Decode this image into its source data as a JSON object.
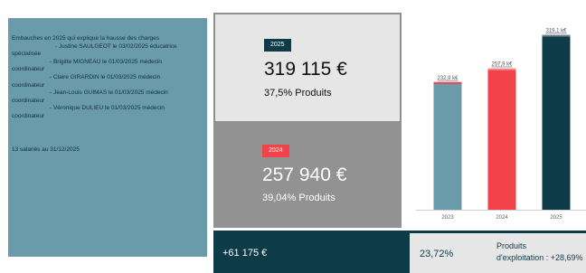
{
  "notes": {
    "lines": [
      "Embauches en 2025 qui explique la hausse des charges",
      "- Justine SAULGEOT le 03/02/2025 éducatrice",
      "spécialisée",
      "- Brigitte MIGNEAU le 01/03/2025 médecin",
      "coordinateur",
      "- Claire GIRARDIN le 01/03/2025 médecin",
      "coordinateur",
      "- Jean-Louis GUIMAS le 01/03/2025 médecin",
      "coordinateur",
      "- Véronique DULIEU le 01/03/2025 médecin",
      "coordinateur"
    ],
    "salaries": "13 salariés au 31/12/2025"
  },
  "card_2025": {
    "tag": "2025",
    "amount": "319 115 €",
    "pct": "37,5% Produits"
  },
  "card_2024": {
    "tag": "2024",
    "amount": "257 940 €",
    "pct": "39,04% Produits"
  },
  "chart_data": {
    "type": "bar",
    "categories": [
      "2023",
      "2024",
      "2025"
    ],
    "values": [
      232.9,
      257.9,
      319.1
    ],
    "data_labels": [
      "232,9 k€",
      "257,9 k€",
      "319,1 k€"
    ],
    "colors": [
      "#6a9bab",
      "#f2434b",
      "#0e3b48"
    ],
    "title": "",
    "xlabel": "",
    "ylabel": "",
    "ylim": [
      0,
      330
    ],
    "grid": false
  },
  "summary": {
    "difference": "+61 175 €",
    "growth": "23,72%",
    "produits_line1": "Produits",
    "produits_line2": "d'exploitation : +28,69%"
  },
  "colors": {
    "dark_teal": "#0e3b48",
    "steel_blue": "#6a9bab",
    "red": "#f2434b",
    "grey": "#929292"
  }
}
